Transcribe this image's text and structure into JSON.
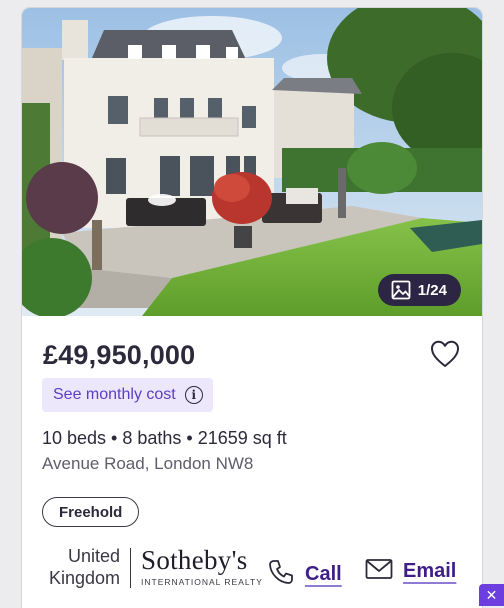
{
  "listing": {
    "photo_counter": "1/24",
    "price": "£49,950,000",
    "monthly_cost_label": "See monthly cost",
    "specs": "10 beds • 8 baths • 21659 sq ft",
    "address": "Avenue Road, London NW8",
    "tenure": "Freehold"
  },
  "agent": {
    "location_line1": "United",
    "location_line2": "Kingdom",
    "brand_name": "Sotheby's",
    "brand_subtitle": "INTERNATIONAL REALTY"
  },
  "contact": {
    "call_label": "Call",
    "email_label": "Email"
  },
  "icons": {
    "gallery": "image-icon",
    "favourite": "heart-outline-icon",
    "info": "info-icon",
    "phone": "phone-icon",
    "email": "envelope-icon",
    "close": "close-icon"
  },
  "colors": {
    "accent_purple": "#5b3fc2",
    "accent_light": "#ece7fb",
    "link_purple": "#3e1f86",
    "counter_bg": "#2c2644"
  }
}
